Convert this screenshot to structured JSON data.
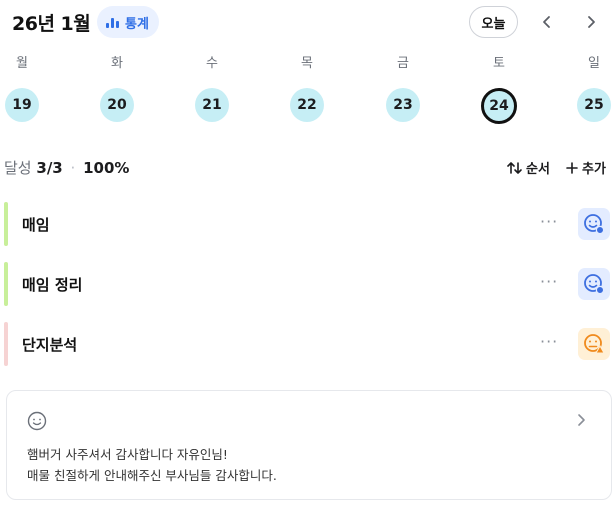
{
  "header": {
    "title": "26년 1월",
    "stats_label": "통계",
    "today_label": "오늘",
    "prev_icon": "chevron-left-icon",
    "next_icon": "chevron-right-icon"
  },
  "week": [
    {
      "dow": "월",
      "date": "19"
    },
    {
      "dow": "화",
      "date": "20"
    },
    {
      "dow": "수",
      "date": "21"
    },
    {
      "dow": "목",
      "date": "22"
    },
    {
      "dow": "금",
      "date": "23"
    },
    {
      "dow": "토",
      "date": "24",
      "selected": true
    },
    {
      "dow": "일",
      "date": "25"
    }
  ],
  "summary": {
    "label": "달성",
    "count": "3/3",
    "separator": "·",
    "percent": "100%",
    "sort_label": "순서",
    "add_label": "추가"
  },
  "tasks": [
    {
      "name": "매임",
      "bar_color": "#c8ef9a",
      "face": "smile-face-icon",
      "face_color": "#3d6fe0",
      "face_bg": "#e3ecff"
    },
    {
      "name": "매임 정리",
      "bar_color": "#c8ef9a",
      "face": "smile-face-icon",
      "face_color": "#3d6fe0",
      "face_bg": "#e3ecff"
    },
    {
      "name": "단지분석",
      "bar_color": "#f6d3d3",
      "face": "worried-face-icon",
      "face_color": "#f08a1c",
      "face_bg": "#fff0d6"
    }
  ],
  "memo": {
    "icon": "smile-outline-icon",
    "line1": "햄버거 사주셔서 감사합니다 자유인님!",
    "line2": "매물 친절하게 안내해주신 부사님들 감사합니다."
  }
}
